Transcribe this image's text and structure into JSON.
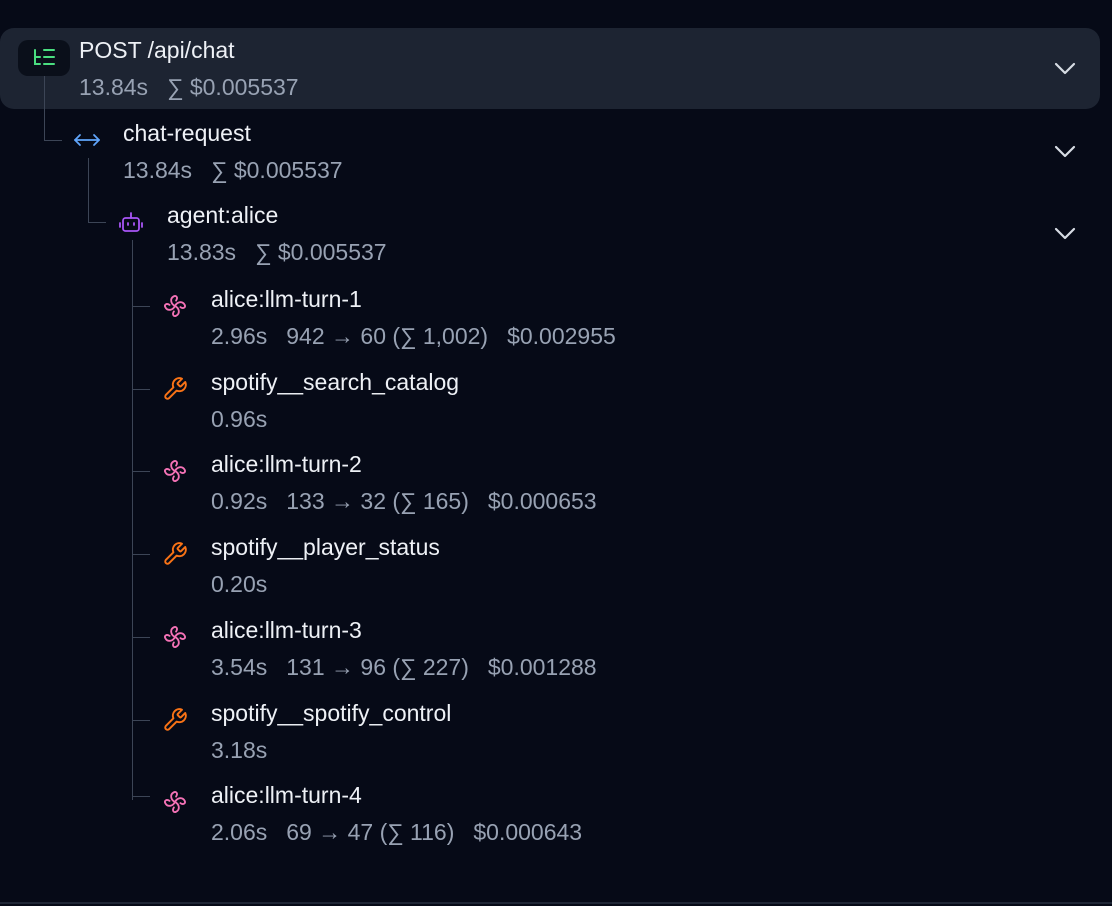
{
  "colors": {
    "background": "#060a17",
    "selected_row": "#1d2432",
    "title_text": "#eef1f6",
    "meta_text": "#98a2b3",
    "guide_line": "#3c4556",
    "root_icon": "#4ade80",
    "request_icon": "#60a5fa",
    "agent_icon": "#a855f7",
    "llm_icon": "#f472b6",
    "tool_icon": "#f97316",
    "chevron": "#d7dce4"
  },
  "root": {
    "icon": "trace-tree-icon",
    "title": "POST /api/chat",
    "duration": "13.84s",
    "cost": "∑ $0.005537",
    "expanded": true
  },
  "request": {
    "icon": "bidirectional-arrow-icon",
    "title": "chat-request",
    "duration": "13.84s",
    "cost": "∑ $0.005537",
    "expanded": true
  },
  "agent": {
    "icon": "robot-icon",
    "title": "agent:alice",
    "duration": "13.83s",
    "cost": "∑ $0.005537",
    "expanded": true
  },
  "spans": [
    {
      "icon": "llm-icon",
      "title": "alice:llm-turn-1",
      "duration": "2.96s",
      "tokens": "942 → 60 (∑ 1,002)",
      "cost": "$0.002955"
    },
    {
      "icon": "wrench-icon",
      "title": "spotify__search_catalog",
      "duration": "0.96s"
    },
    {
      "icon": "llm-icon",
      "title": "alice:llm-turn-2",
      "duration": "0.92s",
      "tokens": "133 → 32 (∑ 165)",
      "cost": "$0.000653"
    },
    {
      "icon": "wrench-icon",
      "title": "spotify__player_status",
      "duration": "0.20s"
    },
    {
      "icon": "llm-icon",
      "title": "alice:llm-turn-3",
      "duration": "3.54s",
      "tokens": "131 → 96 (∑ 227)",
      "cost": "$0.001288"
    },
    {
      "icon": "wrench-icon",
      "title": "spotify__spotify_control",
      "duration": "3.18s"
    },
    {
      "icon": "llm-icon",
      "title": "alice:llm-turn-4",
      "duration": "2.06s",
      "tokens": "69 → 47 (∑ 116)",
      "cost": "$0.000643"
    }
  ]
}
